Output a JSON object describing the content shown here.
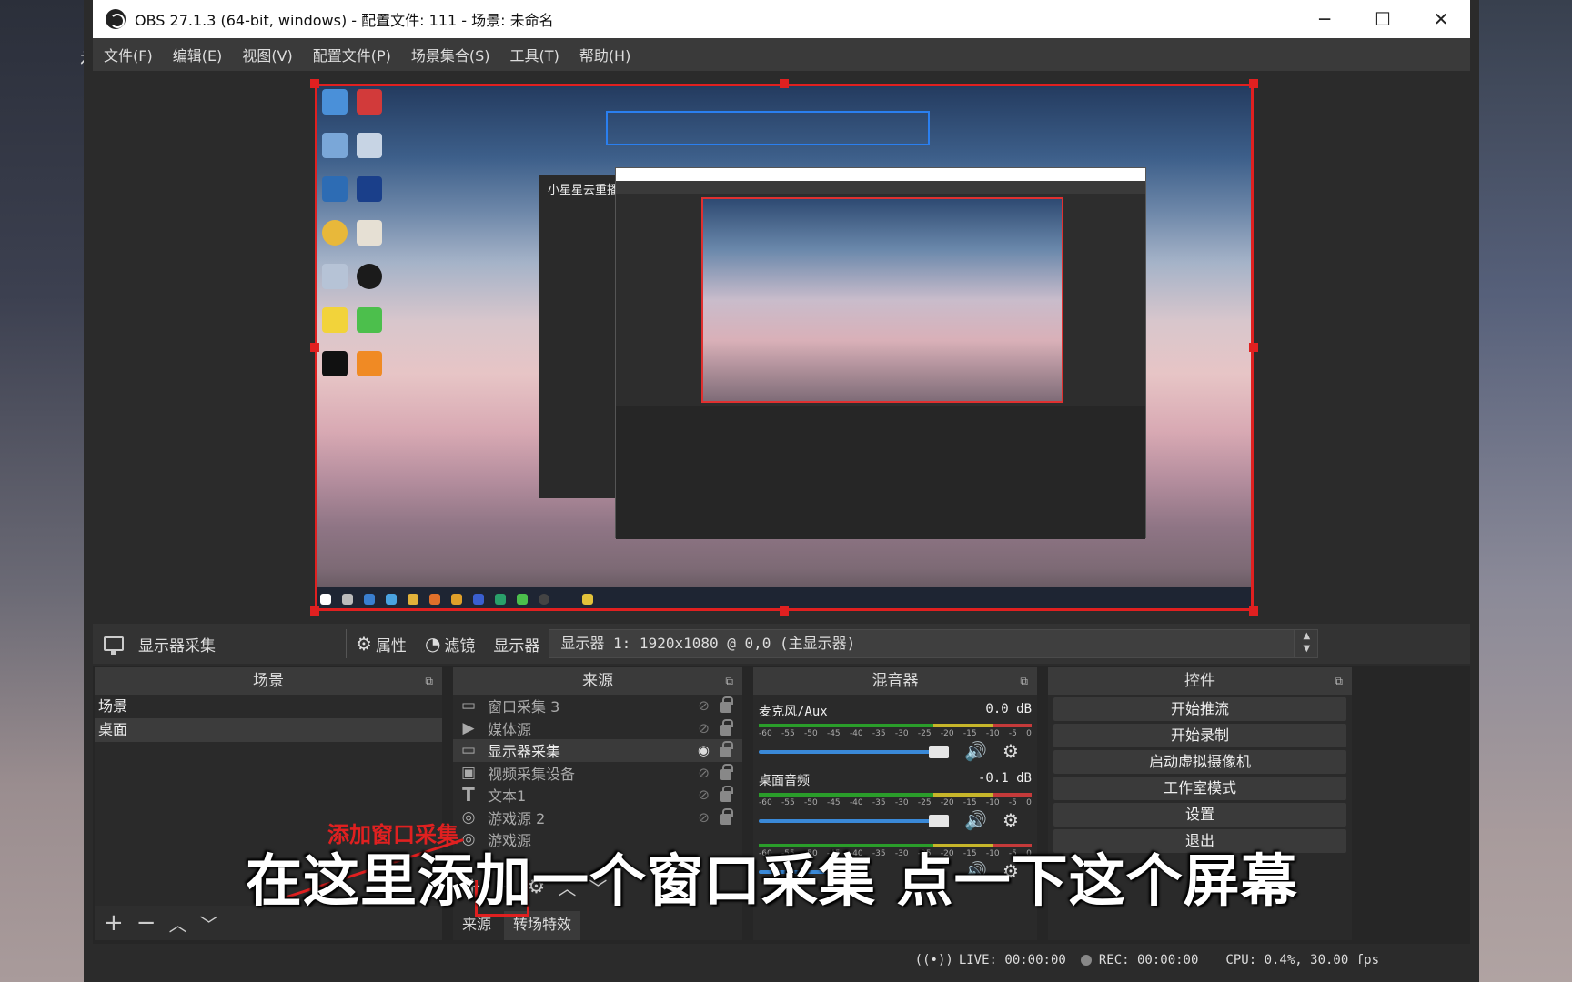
{
  "window": {
    "title": "OBS 27.1.3 (64-bit, windows) - 配置文件: 111 - 场景: 未命名",
    "minimize": "─",
    "maximize": "☐",
    "close": "✕"
  },
  "menu": [
    "文件(F)",
    "编辑(E)",
    "视图(V)",
    "配置文件(P)",
    "场景集合(S)",
    "工具(T)",
    "帮助(H)"
  ],
  "preview": {
    "behind_window_label": "小星星去重播"
  },
  "toolbar": {
    "source_name": "显示器采集",
    "properties_label": "属性",
    "filters_label": "滤镜",
    "display_label": "显示器",
    "display_value": "显示器 1: 1920x1080 @ 0,0 (主显示器)"
  },
  "scenes": {
    "title": "场景",
    "items": [
      "场景",
      "桌面"
    ],
    "active_index": 1
  },
  "sources": {
    "title": "来源",
    "items": [
      {
        "icon": "window-icon",
        "label": "窗口采集 3"
      },
      {
        "icon": "play-icon",
        "label": "媒体源"
      },
      {
        "icon": "monitor-icon",
        "label": "显示器采集"
      },
      {
        "icon": "camera-icon",
        "label": "视频采集设备"
      },
      {
        "icon": "text-icon",
        "label": "文本1"
      },
      {
        "icon": "gamepad-icon",
        "label": "游戏源 2"
      },
      {
        "icon": "gamepad-icon",
        "label": "游戏源"
      }
    ],
    "active_index": 2,
    "tab_sources": "来源",
    "tab_transitions": "转场特效"
  },
  "mixer": {
    "title": "混音器",
    "channels": [
      {
        "name": "麦克风/Aux",
        "db": "0.0 dB",
        "level": 0.93
      },
      {
        "name": "桌面音频",
        "db": "-0.1 dB",
        "level": 0.93
      },
      {
        "name": "",
        "db": "",
        "level": 0.49
      }
    ],
    "scale": [
      "-60",
      "-55",
      "-50",
      "-45",
      "-40",
      "-35",
      "-30",
      "-25",
      "-20",
      "-15",
      "-10",
      "-5",
      "0"
    ]
  },
  "controls": {
    "title": "控件",
    "buttons": [
      "开始推流",
      "开始录制",
      "启动虚拟摄像机",
      "工作室模式",
      "设置",
      "退出"
    ]
  },
  "status": {
    "live": "LIVE: 00:00:00",
    "rec": "REC: 00:00:00",
    "cpu": "CPU: 0.4%, 30.00 fps"
  },
  "overlay": {
    "subtitle": "在这里添加一个窗口采集 点一下这个屏幕",
    "annotation": "添加窗口采集"
  },
  "colors": {
    "selection_red": "#e02020",
    "fader_blue": "#3a89d8",
    "panel_bg": "#2a2a2a"
  }
}
